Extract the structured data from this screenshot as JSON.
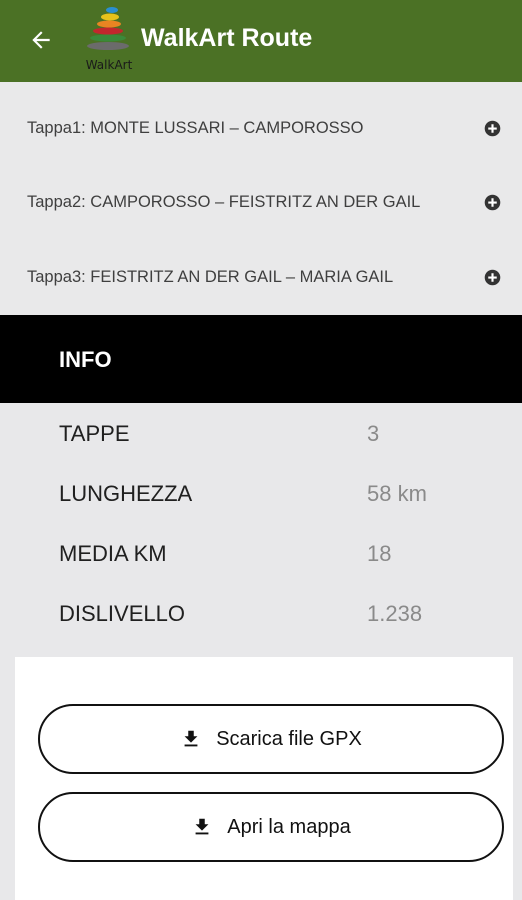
{
  "header": {
    "title": "WalkArt Route",
    "logo_text": "WalkArt",
    "back_icon": "arrow-left-icon"
  },
  "stages": [
    {
      "label": "Tappa1: MONTE LUSSARI – CAMPOROSSO",
      "icon": "plus-circle-icon"
    },
    {
      "label": "Tappa2: CAMPOROSSO – FEISTRITZ AN DER GAIL",
      "icon": "plus-circle-icon"
    },
    {
      "label": "Tappa3: FEISTRITZ AN DER GAIL – MARIA GAIL",
      "icon": "plus-circle-icon"
    }
  ],
  "info": {
    "title": "INFO",
    "rows": [
      {
        "label": "TAPPE",
        "value": "3"
      },
      {
        "label": "LUNGHEZZA",
        "value": "58 km"
      },
      {
        "label": "MEDIA KM",
        "value": "18"
      },
      {
        "label": "DISLIVELLO",
        "value": "1.238"
      }
    ]
  },
  "actions": {
    "download_gpx": "Scarica file GPX",
    "open_map": "Apri la mappa",
    "icon": "download-icon"
  },
  "colors": {
    "appbar": "#4b7125",
    "info_header": "#000000"
  }
}
